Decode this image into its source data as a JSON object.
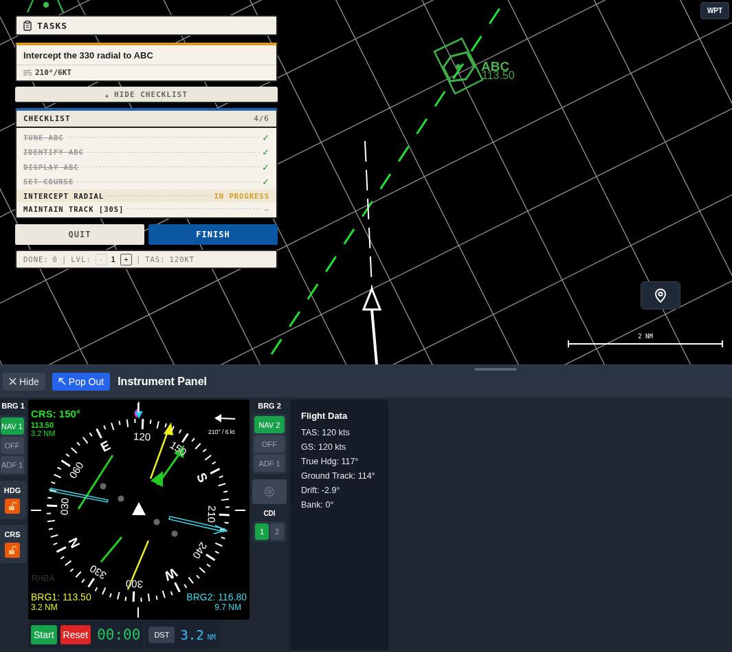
{
  "map": {
    "waypoint_button": "WPT",
    "vor": {
      "ident": "ABC",
      "frequency": "113.50"
    },
    "scale": "2 NM"
  },
  "tasks": {
    "title": "TASKS",
    "task": {
      "title": "Intercept the 330 radial to ABC",
      "wind": "210°/6KT"
    },
    "hide_checklist": {
      "icon": "▲",
      "label": "HIDE CHECKLIST"
    },
    "checklist": {
      "title": "CHECKLIST",
      "count": "4/6",
      "items": [
        {
          "label": "TUNE ABC",
          "done": true,
          "active": false,
          "mark": "✓"
        },
        {
          "label": "IDENTIFY ABC",
          "done": true,
          "active": false,
          "mark": "✓"
        },
        {
          "label": "DISPLAY ABC",
          "done": true,
          "active": false,
          "mark": "✓"
        },
        {
          "label": "SET COURSE",
          "done": true,
          "active": false,
          "mark": "✓"
        },
        {
          "label": "INTERCEPT RADIAL",
          "done": false,
          "active": true,
          "mark": "IN PROGRESS"
        },
        {
          "label": "MAINTAIN TRACK [30S]",
          "done": false,
          "active": false,
          "mark": "–"
        }
      ]
    },
    "buttons": [
      {
        "label": "QUIT",
        "kind": "secondary"
      },
      {
        "label": "FINISH",
        "kind": "primary"
      }
    ],
    "footer": {
      "done_label": "DONE:",
      "done_value": "0",
      "separators": [
        "|",
        "|"
      ],
      "level_label": "LVL:",
      "level_minus": "-",
      "level_value": "1",
      "level_plus": "+",
      "tas_label": "TAS:",
      "tas_value": "120KT"
    }
  },
  "instrument_panel": {
    "hide_button": "Hide",
    "popout_button": "Pop Out",
    "title": "Instrument Panel",
    "brg1": {
      "label": "BRG 1",
      "options": [
        {
          "label": "NAV 1",
          "selected": true
        },
        {
          "label": "OFF",
          "selected": false
        },
        {
          "label": "ADF 1",
          "selected": false
        }
      ]
    },
    "hdg": {
      "label": "HDG",
      "locked": false
    },
    "crs": {
      "label": "CRS",
      "locked": false
    },
    "compass": {
      "course": "CRS: 150°",
      "course_frequency": "113.50",
      "course_distance": "3.2 NM",
      "wind": "210° / 6 kt",
      "dial_labels": [
        "120",
        "150",
        "S",
        "210",
        "240",
        "W",
        "300",
        "330",
        "N",
        "030",
        "060",
        "E"
      ],
      "source": "RHBA",
      "brg1": {
        "frequency": "BRG1: 113.50",
        "distance": "3.2 NM"
      },
      "brg2": {
        "frequency": "BRG2: 116.80",
        "distance": "9.7 NM"
      }
    },
    "brg2": {
      "label": "BRG 2",
      "options": [
        {
          "label": "NAV 2",
          "selected": true
        },
        {
          "label": "OFF",
          "selected": false
        },
        {
          "label": "ADF 1",
          "selected": false
        }
      ]
    },
    "cdi": {
      "label": "CDI",
      "options": [
        {
          "label": "1",
          "selected": true
        },
        {
          "label": "2",
          "selected": false
        }
      ]
    },
    "timer": {
      "start": "Start",
      "reset": "Reset",
      "time": "00:00"
    },
    "distance": {
      "button": "DST",
      "value": "3.2",
      "unit": "NM"
    },
    "flight_data": {
      "title": "Flight Data",
      "rows": [
        "TAS: 120 kts",
        "GS: 120 kts",
        "True Hdg: 117°",
        "Ground Track: 114°",
        "Drift: -2.9°",
        "Bank: 0°"
      ]
    }
  }
}
